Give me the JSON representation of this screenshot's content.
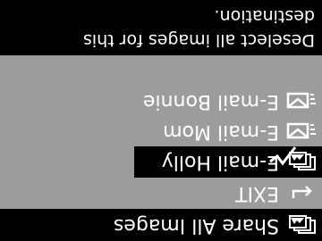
{
  "menu": {
    "items": [
      {
        "label": "Share All Images",
        "icon": "multi-images-icon",
        "highlighted": true
      },
      {
        "label": "EXIT",
        "icon": "return-arrow-icon",
        "highlighted": false
      },
      {
        "label": "E-mail Holly",
        "icon": "multi-images-icon",
        "highlighted": true
      },
      {
        "label": "E-mail Mom",
        "icon": "email-envelope-icon",
        "highlighted": false
      },
      {
        "label": "E-mail Bonnie",
        "icon": "email-envelope-icon",
        "highlighted": false
      }
    ]
  },
  "help": {
    "line1": "Deselect all images for this",
    "line2": "destination."
  },
  "colors": {
    "screen_bg": "#9c9c9c",
    "highlight_bg": "#000000",
    "text": "#ffffff"
  }
}
